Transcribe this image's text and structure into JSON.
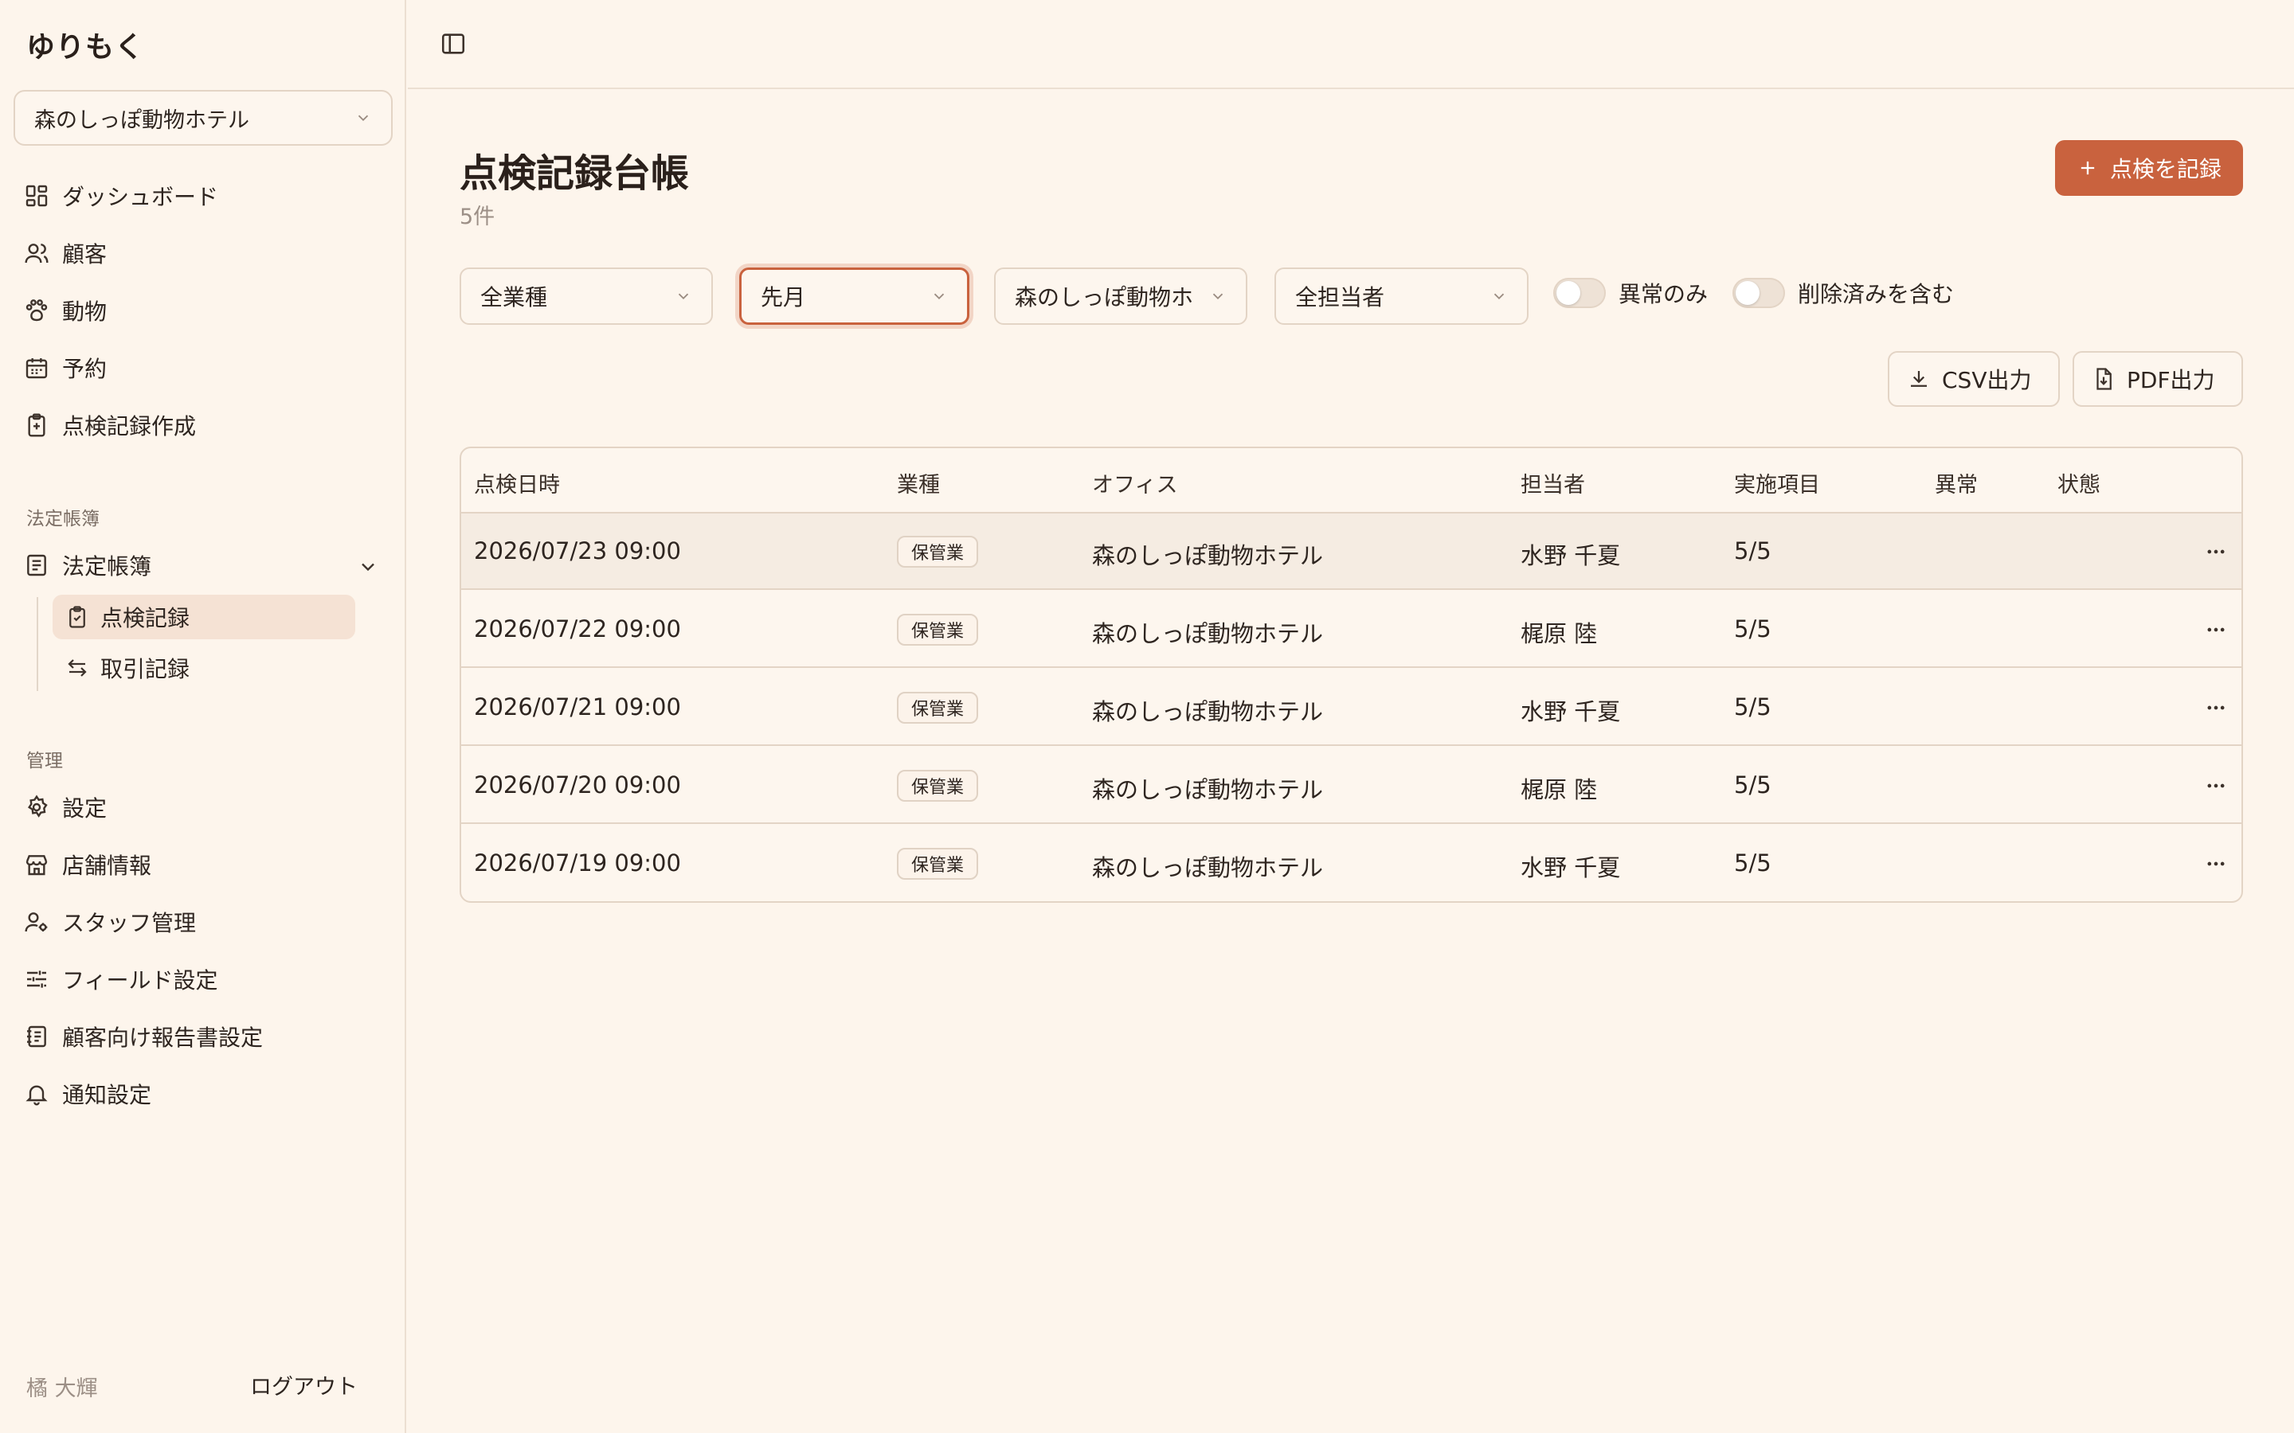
{
  "brand": "ゆりもく",
  "office_selector": {
    "value": "森のしっぽ動物ホテル"
  },
  "nav": [
    {
      "label": "ダッシュボード",
      "icon": "dashboard-icon"
    },
    {
      "label": "顧客",
      "icon": "users-icon"
    },
    {
      "label": "動物",
      "icon": "paw-icon"
    },
    {
      "label": "予約",
      "icon": "calendar-icon"
    },
    {
      "label": "点検記録作成",
      "icon": "clipboard-plus-icon"
    }
  ],
  "legal_section": {
    "label": "法定帳簿",
    "group_label": "法定帳簿",
    "sub_items": [
      {
        "label": "点検記録",
        "active": true
      },
      {
        "label": "取引記録",
        "active": false
      }
    ]
  },
  "admin_section": {
    "label": "管理",
    "items": [
      {
        "label": "設定"
      },
      {
        "label": "店舗情報"
      },
      {
        "label": "スタッフ管理"
      },
      {
        "label": "フィールド設定"
      },
      {
        "label": "顧客向け報告書設定"
      },
      {
        "label": "通知設定"
      }
    ]
  },
  "user": {
    "name": "橘 大輝",
    "logout": "ログアウト"
  },
  "page": {
    "title": "点検記録台帳",
    "count": "5件",
    "add_button": "点検を記録"
  },
  "filters": {
    "business_type": "全業種",
    "period": "先月",
    "office": "森のしっぽ動物ホ",
    "staff": "全担当者",
    "anomaly_only": "異常のみ",
    "include_deleted": "削除済みを含む"
  },
  "export": {
    "csv": "CSV出力",
    "pdf": "PDF出力"
  },
  "table": {
    "headers": [
      "点検日時",
      "業種",
      "オフィス",
      "担当者",
      "実施項目",
      "異常",
      "状態"
    ],
    "rows": [
      {
        "datetime": "2026/07/23 09:00",
        "type": "保管業",
        "office": "森のしっぽ動物ホテル",
        "staff": "水野 千夏",
        "items": "5/5",
        "anomaly": "",
        "status": ""
      },
      {
        "datetime": "2026/07/22 09:00",
        "type": "保管業",
        "office": "森のしっぽ動物ホテル",
        "staff": "梶原 陸",
        "items": "5/5",
        "anomaly": "",
        "status": ""
      },
      {
        "datetime": "2026/07/21 09:00",
        "type": "保管業",
        "office": "森のしっぽ動物ホテル",
        "staff": "水野 千夏",
        "items": "5/5",
        "anomaly": "",
        "status": ""
      },
      {
        "datetime": "2026/07/20 09:00",
        "type": "保管業",
        "office": "森のしっぽ動物ホテル",
        "staff": "梶原 陸",
        "items": "5/5",
        "anomaly": "",
        "status": ""
      },
      {
        "datetime": "2026/07/19 09:00",
        "type": "保管業",
        "office": "森のしっぽ動物ホテル",
        "staff": "水野 千夏",
        "items": "5/5",
        "anomaly": "",
        "status": ""
      }
    ]
  },
  "colors": {
    "accent": "#c9623e",
    "background": "#fdf5ec",
    "border": "#e3d4c5"
  }
}
